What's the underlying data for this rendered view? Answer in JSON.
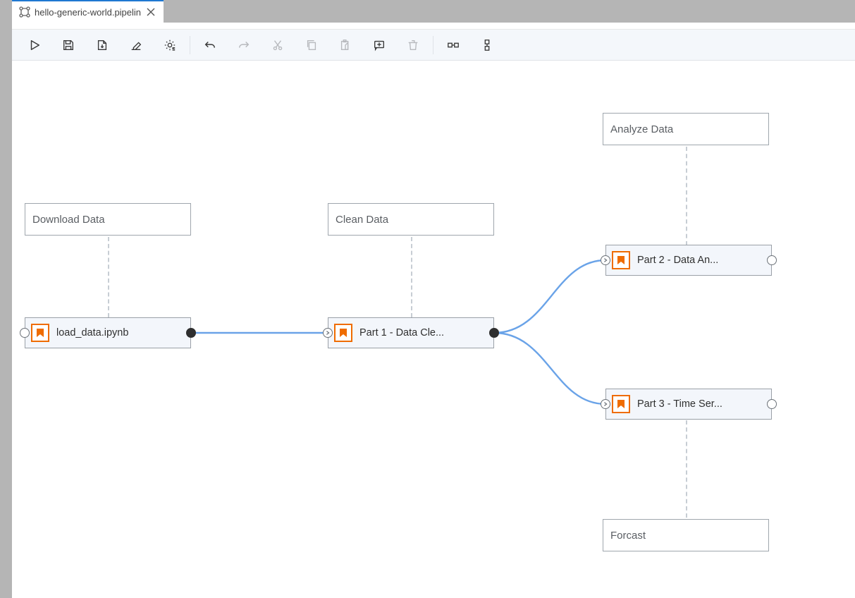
{
  "tab": {
    "title": "hello-generic-world.pipelin",
    "icon": "pipeline-icon"
  },
  "toolbar": {
    "buttons": [
      {
        "name": "run",
        "enabled": true
      },
      {
        "name": "save",
        "enabled": true
      },
      {
        "name": "export",
        "enabled": true
      },
      {
        "name": "clear",
        "enabled": true
      },
      {
        "name": "runtimes",
        "enabled": true
      },
      {
        "sep": true
      },
      {
        "name": "undo",
        "enabled": true
      },
      {
        "name": "redo",
        "enabled": false
      },
      {
        "name": "cut",
        "enabled": false
      },
      {
        "name": "copy",
        "enabled": false
      },
      {
        "name": "paste",
        "enabled": false
      },
      {
        "name": "add-comment",
        "enabled": true
      },
      {
        "name": "delete",
        "enabled": false
      },
      {
        "sep": true
      },
      {
        "name": "arrange-horizontal",
        "enabled": true
      },
      {
        "name": "arrange-vertical",
        "enabled": true
      }
    ]
  },
  "comments": {
    "download": {
      "text": "Download Data"
    },
    "clean": {
      "text": "Clean Data"
    },
    "analyze": {
      "text": "Analyze Data"
    },
    "forecast": {
      "text": "Forcast"
    }
  },
  "nodes": {
    "load": {
      "label": "load_data.ipynb"
    },
    "part1": {
      "label": "Part 1 - Data Cle..."
    },
    "part2": {
      "label": "Part 2 - Data An..."
    },
    "part3": {
      "label": "Part 3 - Time Ser..."
    }
  }
}
